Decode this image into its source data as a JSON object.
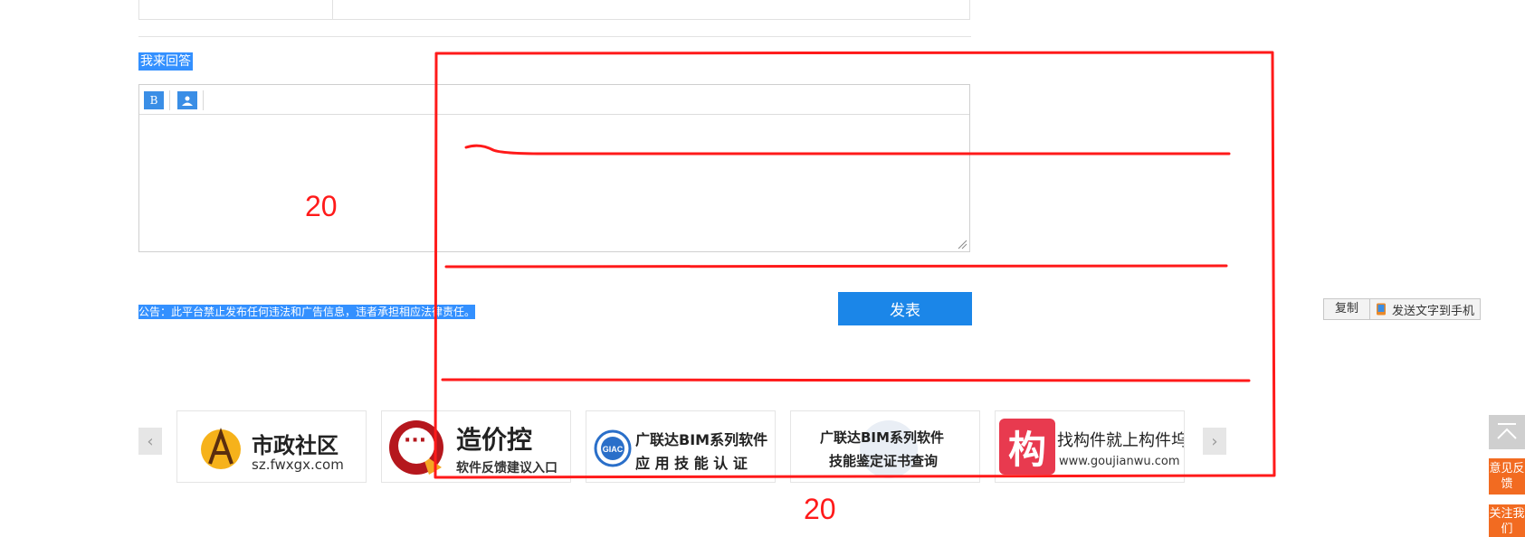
{
  "answer_heading": "我来回答",
  "editor_toolbar": {
    "bold_label": "B",
    "image_icon": "image-icon"
  },
  "notice": "公告：此平台禁止发布任何违法和广告信息，违者承担相应法律责任。",
  "submit_label": "发表",
  "copy_bar": {
    "copy_label": "复制",
    "send_label": "发送文字到手机"
  },
  "carousel": {
    "prev": "‹",
    "next": "›",
    "banners": [
      {
        "title": "市政社区",
        "subtitle": "sz.fwxgx.com"
      },
      {
        "title": "造价控",
        "subtitle": "软件反馈建议入口",
        "logo_text": "···"
      },
      {
        "title": "广联达BIM系列软件",
        "subtitle": "应 用 技 能 认 证",
        "logo_text": "GIAC"
      },
      {
        "title": "广联达BIM系列软件",
        "subtitle": "技能鉴定证书查询"
      },
      {
        "title": "找构件就上构件坞",
        "subtitle": "www.goujianwu.com",
        "logo_text": "构"
      }
    ]
  },
  "side": {
    "feedback_label": "意见反馈",
    "follow_label": "关注我们"
  },
  "annotations": {
    "left_number": "20",
    "bottom_number": "20",
    "color": "#ff1a1a"
  },
  "colors": {
    "primary": "#1b86e8",
    "orange": "#f26b21",
    "selection": "#3390ff"
  }
}
